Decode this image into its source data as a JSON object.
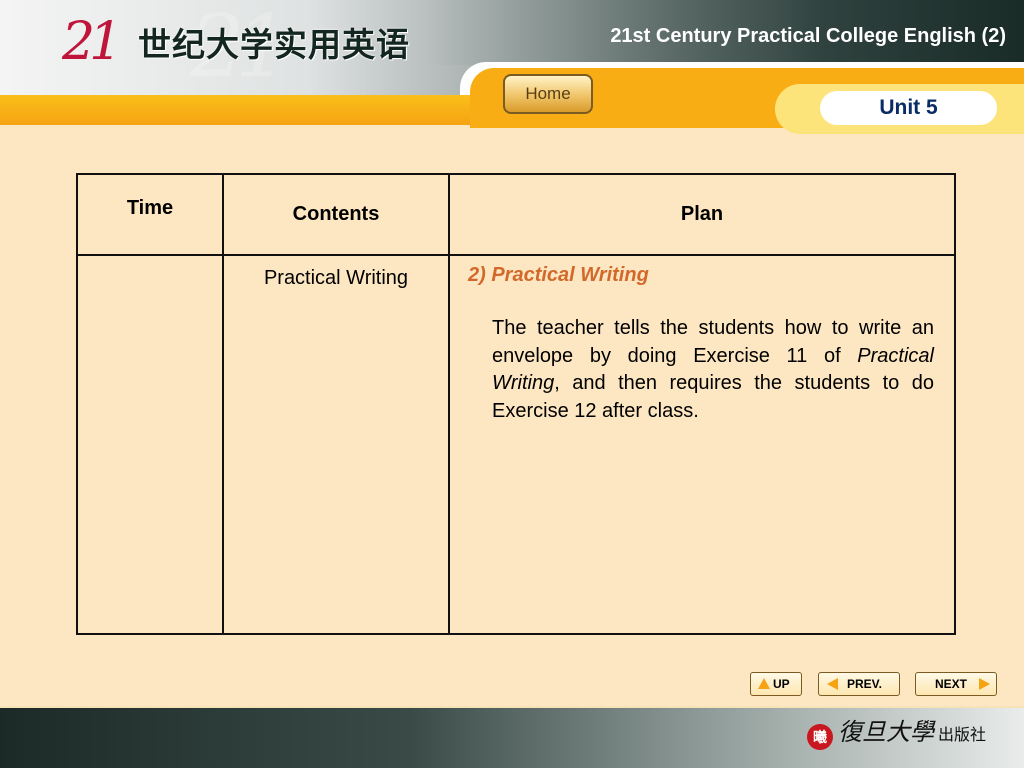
{
  "header": {
    "logo_number": "21",
    "logo_title": "世纪大学实用英语",
    "course_title": "21st Century Practical College English (2)",
    "home_label": "Home",
    "unit_label": "Unit 5"
  },
  "table": {
    "headers": {
      "time": "Time",
      "contents": "Contents",
      "plan": "Plan"
    },
    "row": {
      "time": "",
      "contents": "Practical Writing",
      "plan_heading": "2) Practical Writing",
      "plan_text_1": "The teacher tells the students how to write an envelope by doing Exercise 11 of ",
      "plan_text_italic": "Practical Writing",
      "plan_text_2": ", and then requires the students to do Exercise 12 after class."
    }
  },
  "nav": {
    "up_label": "UP",
    "prev_label": "PREV.",
    "next_label": "NEXT"
  },
  "footer": {
    "publisher_seal": "曦",
    "publisher_name": "復旦大學",
    "publisher_suffix": "出版社"
  },
  "colors": {
    "accent_orange": "#f5a312",
    "plan_heading": "#d2692b",
    "unit_text": "#0a2c66",
    "logo_red": "#c0153a"
  },
  "icons": {
    "up": "triangle-up-icon",
    "prev": "triangle-left-icon",
    "next": "triangle-right-icon"
  }
}
